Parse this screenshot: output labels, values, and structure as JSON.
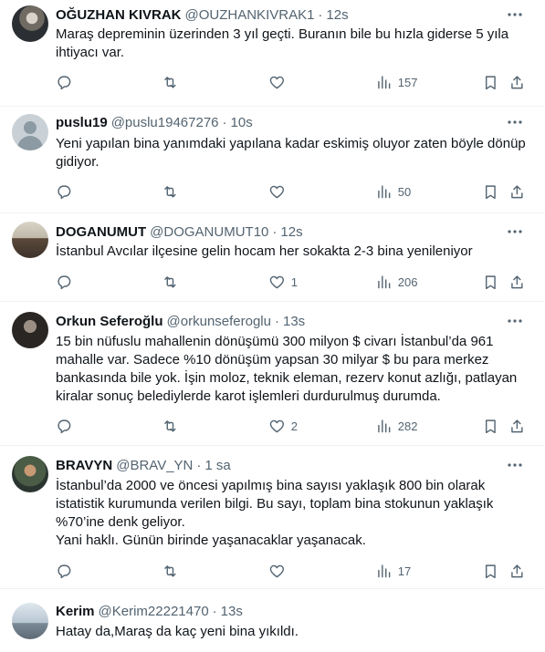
{
  "tweets": [
    {
      "name": "OĞUZHAN KIVRAK",
      "handle": "@OUZHANKIVRAK1",
      "dot": "·",
      "time": "12s",
      "text": "Maraş depreminin üzerinden 3 yıl geçti. Buranın bile bu hızla giderse 5 yıla ihtiyacı var.",
      "likes": "",
      "views": "157"
    },
    {
      "name": "puslu19",
      "handle": "@puslu19467276",
      "dot": "·",
      "time": "10s",
      "text": "Yeni yapılan bina yanımdaki yapılana kadar eskimiş oluyor zaten böyle dönüp gidiyor.",
      "likes": "",
      "views": "50"
    },
    {
      "name": "DOGANUMUT",
      "handle": "@DOGANUMUT10",
      "dot": "·",
      "time": "12s",
      "text": "İstanbul Avcılar ilçesine gelin hocam her sokakta 2-3 bina yenileniyor",
      "likes": "1",
      "views": "206"
    },
    {
      "name": "Orkun Seferoğlu",
      "handle": "@orkunseferoglu",
      "dot": "·",
      "time": "13s",
      "text": "15 bin nüfuslu mahallenin dönüşümü 300 milyon $ civarı İstanbul’da 961 mahalle var. Sadece %10 dönüşüm yapsan 30 milyar $ bu para merkez bankasında bile yok. İşin moloz, teknik eleman, rezerv konut azlığı, patlayan kiralar sonuç belediylerde karot işlemleri durdurulmuş durumda.",
      "likes": "2",
      "views": "282"
    },
    {
      "name": "BRAVYN",
      "handle": "@BRAV_YN",
      "dot": "·",
      "time": "1 sa",
      "text": "İstanbul’da 2000 ve öncesi yapılmış bina sayısı yaklaşık 800 bin olarak istatistik kurumunda verilen bilgi.  Bu sayı, toplam bina stokunun yaklaşık %70’ine denk geliyor.\nYani haklı. Günün birinde yaşanacaklar yaşanacak.",
      "likes": "",
      "views": "17"
    },
    {
      "name": "Kerim",
      "handle": "@Kerim22221470",
      "dot": "·",
      "time": "13s",
      "text": "Hatay da,Maraş da kaç yeni bina yıkıldı."
    }
  ],
  "icons": {
    "more": "more-icon",
    "reply": "reply-icon",
    "retweet": "retweet-icon",
    "like": "like-icon",
    "views": "views-icon",
    "bookmark": "bookmark-icon",
    "share": "share-icon"
  },
  "colors": {
    "secondary_text": "#536471",
    "primary_text": "#0f1419",
    "divider": "#eff3f4"
  }
}
